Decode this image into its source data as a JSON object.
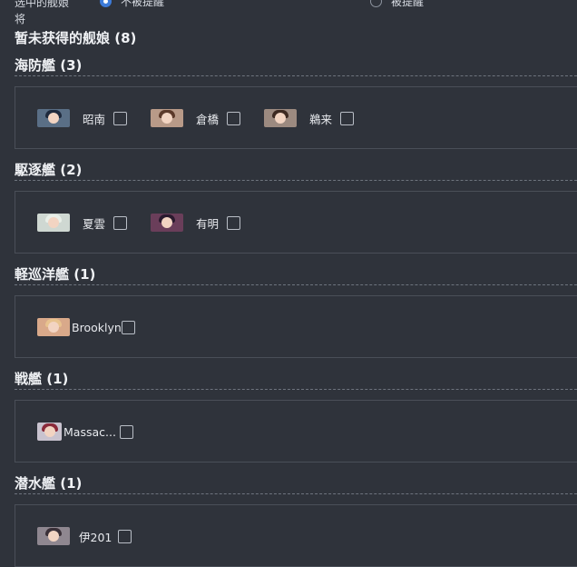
{
  "top": {
    "label": "选中的舰娘",
    "option_not_reminded": "不被提醒",
    "option_reminded": "被提醒",
    "continuation": "将"
  },
  "section": {
    "title": "暂未获得的舰娘 (8)"
  },
  "categories": [
    {
      "name": "海防艦 (3)",
      "ships": [
        {
          "name": "昭南",
          "icon": "ship-portrait-icon"
        },
        {
          "name": "倉橋",
          "icon": "ship-portrait-icon"
        },
        {
          "name": "鵜来",
          "icon": "ship-portrait-icon"
        }
      ]
    },
    {
      "name": "駆逐艦 (2)",
      "ships": [
        {
          "name": "夏雲",
          "icon": "ship-portrait-icon"
        },
        {
          "name": "有明",
          "icon": "ship-portrait-icon"
        }
      ]
    },
    {
      "name": "軽巡洋艦 (1)",
      "ships": [
        {
          "name": "Brooklyn",
          "icon": "ship-portrait-icon"
        }
      ]
    },
    {
      "name": "戦艦 (1)",
      "ships": [
        {
          "name": "Massac...",
          "icon": "ship-portrait-icon"
        }
      ]
    },
    {
      "name": "潜水艦 (1)",
      "ships": [
        {
          "name": "伊201",
          "icon": "ship-portrait-icon"
        }
      ]
    }
  ],
  "colors": {
    "background": "#2f333b",
    "accent": "#3d7bd9",
    "border": "#4a4f58"
  }
}
